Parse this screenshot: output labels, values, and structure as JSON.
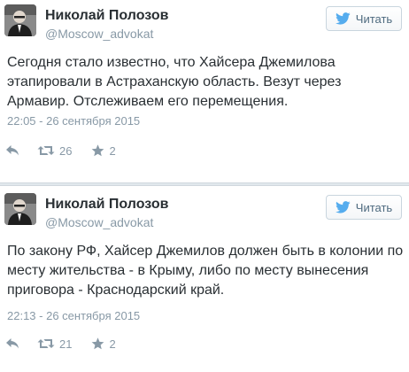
{
  "tweets": [
    {
      "author_name": "Николай Полозов",
      "author_handle": "@Moscow_advokat",
      "follow_label": "Читать",
      "text": "Сегодня стало известно, что Хайсера Джемилова этапировали в Астраханскую область. Везут через Армавир. Отслеживаем его перемещения.",
      "timestamp": "22:05 - 26 сентября 2015",
      "retweets": "26",
      "favorites": "2"
    },
    {
      "author_name": "Николай Полозов",
      "author_handle": "@Moscow_advokat",
      "follow_label": "Читать",
      "text": "По закону РФ, Хайсер Джемилов должен быть в колонии по месту жительства - в Крыму, либо по месту вынесения приговора - Краснодарский край.",
      "timestamp": "22:13 - 26 сентября 2015",
      "retweets": "21",
      "favorites": "2"
    }
  ],
  "colors": {
    "accent": "#55acee",
    "muted": "#8899a6",
    "text": "#292f33"
  },
  "icons": [
    "twitter-bird-icon",
    "reply-icon",
    "retweet-icon",
    "favorite-star-icon"
  ]
}
